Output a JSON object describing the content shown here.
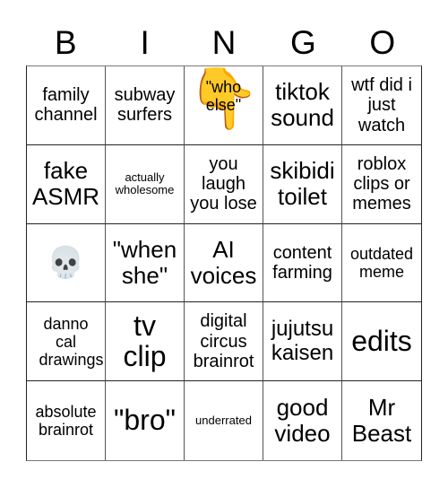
{
  "header": {
    "letters": [
      "B",
      "I",
      "N",
      "G",
      "O"
    ]
  },
  "board": {
    "cells": [
      {
        "text": "family channel"
      },
      {
        "text": "subway surfers"
      },
      {
        "text": "\"who else\"",
        "icon": "pointing-down-hand-icon",
        "glyph": "👇"
      },
      {
        "text": "tiktok sound"
      },
      {
        "text": "wtf did i just watch"
      },
      {
        "text": "fake ASMR"
      },
      {
        "text": "actually wholesome"
      },
      {
        "text": "you laugh you lose"
      },
      {
        "text": "skibidi toilet"
      },
      {
        "text": "roblox clips or memes"
      },
      {
        "text": "",
        "icon": "skull-icon",
        "glyph": "💀"
      },
      {
        "text": "\"when she\""
      },
      {
        "text": "AI voices"
      },
      {
        "text": "content farming"
      },
      {
        "text": "outdated meme"
      },
      {
        "text": "danno cal drawings"
      },
      {
        "text": "tv clip"
      },
      {
        "text": "digital circus brainrot"
      },
      {
        "text": "jujutsu kaisen"
      },
      {
        "text": "edits"
      },
      {
        "text": "absolute brainrot"
      },
      {
        "text": "\"bro\""
      },
      {
        "text": "underrated"
      },
      {
        "text": "good video"
      },
      {
        "text": "Mr Beast"
      }
    ]
  }
}
